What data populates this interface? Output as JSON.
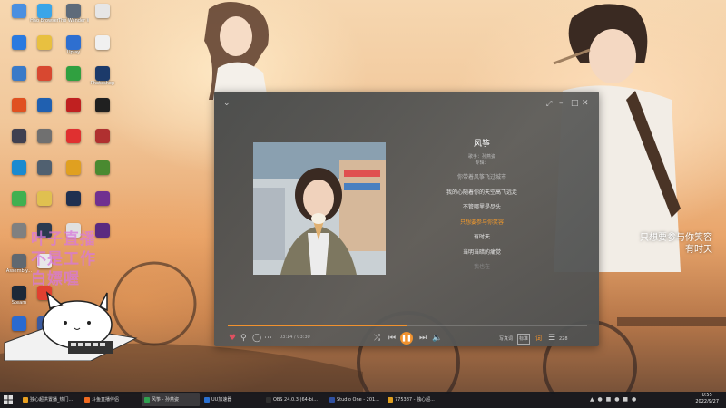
{
  "desktop": {
    "icons": [
      {
        "label": "",
        "color": "#4a8fe0"
      },
      {
        "label": "Hao Browser",
        "color": "#3aa5e8"
      },
      {
        "label": "The Wander\nWild Host",
        "color": "#5e6b7a"
      },
      {
        "label": "",
        "color": "#e6e6e6"
      },
      {
        "label": "",
        "color": "#2a7ae0"
      },
      {
        "label": "",
        "color": "#e8c040"
      },
      {
        "label": "Uplay",
        "color": "#2e6fd0"
      },
      {
        "label": "",
        "color": "#f0f0f0"
      },
      {
        "label": "",
        "color": "#3a7ac8"
      },
      {
        "label": "",
        "color": "#d84830"
      },
      {
        "label": "",
        "color": "#30a040"
      },
      {
        "label": "Photoshop",
        "color": "#1c3a6a"
      },
      {
        "label": "",
        "color": "#e05020"
      },
      {
        "label": "",
        "color": "#2060b0"
      },
      {
        "label": "",
        "color": "#c02020"
      },
      {
        "label": "",
        "color": "#202020"
      },
      {
        "label": "",
        "color": "#404050"
      },
      {
        "label": "",
        "color": "#707070"
      },
      {
        "label": "",
        "color": "#e03030"
      },
      {
        "label": "",
        "color": "#b03030"
      },
      {
        "label": "",
        "color": "#1a8ad0"
      },
      {
        "label": "",
        "color": "#506070"
      },
      {
        "label": "",
        "color": "#e0a020"
      },
      {
        "label": "",
        "color": "#4a8a30"
      },
      {
        "label": "",
        "color": "#40b050"
      },
      {
        "label": "",
        "color": "#e0c050"
      },
      {
        "label": "",
        "color": "#203050"
      },
      {
        "label": "",
        "color": "#703090"
      },
      {
        "label": "",
        "color": "#808080"
      },
      {
        "label": "",
        "color": "#2a3a50"
      },
      {
        "label": "",
        "color": "#e0e0e0"
      },
      {
        "label": "",
        "color": "#5a2a80"
      },
      {
        "label": "Assembly...",
        "color": "#606870"
      },
      {
        "label": "",
        "color": "#e8e8e8"
      },
      {
        "label": "Steam",
        "color": "#1b2838"
      },
      {
        "label": "",
        "color": "#e04030"
      },
      {
        "label": "",
        "color": "#2a6ad0"
      },
      {
        "label": "",
        "color": "#3a5aa0"
      }
    ],
    "overlay_text": [
      "叶子直播",
      "不是工作",
      "白嫖喔"
    ]
  },
  "player": {
    "song_title": "风筝",
    "singer_line": "歌手：孙燕姿",
    "album_line": "专辑：",
    "lyrics": [
      {
        "text": "你带着风筝飞过城市",
        "state": "dim"
      },
      {
        "text": "我的心随着你的天空高飞远走",
        "state": "normal"
      },
      {
        "text": "不管哪里是尽头",
        "state": "normal"
      },
      {
        "text": "只想要参与你笑容",
        "state": "active"
      },
      {
        "text": "有时天",
        "state": "normal"
      },
      {
        "text": "当明当暗的痛觉",
        "state": "normal"
      },
      {
        "text": "我也在",
        "state": "faint"
      }
    ],
    "time_text": "03:14 / 03:30",
    "progress": 0.5,
    "lyric_mode_label": "写真词",
    "quality_label": "标准",
    "count_label": "228",
    "accent": "#f1922e"
  },
  "desktop_lyric": {
    "line1": "只想要参与你笑容",
    "line2": "有时天"
  },
  "taskbar": {
    "tasks": [
      {
        "label": "独心超洪置播_热门...",
        "color": "#e8a020",
        "active": false
      },
      {
        "label": "斗鱼直播伴侣",
        "color": "#f06a20",
        "active": false
      },
      {
        "label": "风筝 - 孙燕姿",
        "color": "#30a050",
        "active": true
      },
      {
        "label": "UU加速器",
        "color": "#2a70d0",
        "active": false
      },
      {
        "label": "OBS 24.0.3 (64-bi...",
        "color": "#303030",
        "active": false
      },
      {
        "label": "Studio One - 201...",
        "color": "#3050a0",
        "active": false
      },
      {
        "label": "775387 - 独心超...",
        "color": "#e0a020",
        "active": false
      }
    ],
    "clock_time": "0:55",
    "clock_date": "2022/9/27"
  }
}
